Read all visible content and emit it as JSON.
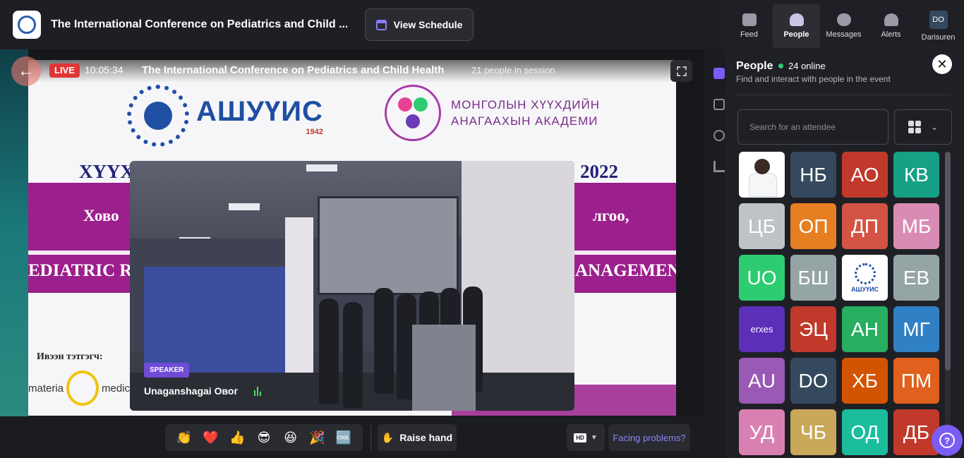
{
  "topbar": {
    "event_title": "The International Conference on Pediatrics and Child ...",
    "schedule_label": "View Schedule"
  },
  "stage": {
    "live_label": "LIVE",
    "live_time": "10:05:34",
    "session_title": "The International Conference on Pediatrics and Child Health",
    "session_count": "21 people in session",
    "slide": {
      "org1_name": "АШУҮИС",
      "org1_year": "1942",
      "org2_line1": "МОНГОЛЫН ХҮҮХДИЙН",
      "org2_line2": "АНАГААХЫН АКАДЕМИ",
      "year_left": "XYYX",
      "year_right": "2022",
      "band_left": "Хово",
      "band_right": "лгоо,",
      "band2_left": "EDIATRIC R",
      "band2_right": "ANAGEMEN",
      "sponsor_label": "Ивээн тэтгэгч:",
      "sponsor_left": "materia",
      "sponsor_right": "medica"
    },
    "speaker_badge": "SPEAKER",
    "speaker_name": "Unaganshagai Овог"
  },
  "toolbar": {
    "reactions": [
      "👏",
      "❤️",
      "👍",
      "😎",
      "😆",
      "🎉",
      "🆒"
    ],
    "raise_hand_label": "Raise hand",
    "hd_label": "HD",
    "problems_label": "Facing problems?"
  },
  "nav": {
    "items": [
      {
        "label": "Feed",
        "icon": "feed-icon"
      },
      {
        "label": "People",
        "icon": "people-icon"
      },
      {
        "label": "Messages",
        "icon": "messages-icon"
      },
      {
        "label": "Alerts",
        "icon": "bell-icon"
      },
      {
        "label": "Darisuren",
        "initials": "DO"
      }
    ],
    "active": "People"
  },
  "people": {
    "title": "People",
    "online": "24 online",
    "subtitle": "Find and interact with people in the event",
    "search_placeholder": "Search for an attendee",
    "attendees": [
      {
        "type": "photo",
        "initials": "",
        "color": "#ffffff"
      },
      {
        "initials": "НБ",
        "color": "#34495e"
      },
      {
        "initials": "АО",
        "color": "#c0392b"
      },
      {
        "initials": "КВ",
        "color": "#16a085"
      },
      {
        "initials": "ЦБ",
        "color": "#bdc3c7"
      },
      {
        "initials": "ОП",
        "color": "#e67e22"
      },
      {
        "initials": "ДП",
        "color": "#d35445"
      },
      {
        "initials": "МБ",
        "color": "#d98cb3"
      },
      {
        "initials": "UO",
        "color": "#2ecc71"
      },
      {
        "initials": "БШ",
        "color": "#95a5a6"
      },
      {
        "type": "logo",
        "initials": "АШУҮИС",
        "color": "#ffffff"
      },
      {
        "initials": "ЕВ",
        "color": "#95a5a6"
      },
      {
        "initials": "erxes",
        "color": "#5b2fb8",
        "small": true
      },
      {
        "initials": "ЭЦ",
        "color": "#c0392b"
      },
      {
        "initials": "АН",
        "color": "#27ae60"
      },
      {
        "initials": "МГ",
        "color": "#2f80c4"
      },
      {
        "initials": "AU",
        "color": "#9b59b6"
      },
      {
        "initials": "DO",
        "color": "#34495e"
      },
      {
        "initials": "ХБ",
        "color": "#d35400"
      },
      {
        "initials": "ПМ",
        "color": "#e0601e"
      },
      {
        "initials": "УД",
        "color": "#d980b3"
      },
      {
        "initials": "ЧБ",
        "color": "#c9a85a"
      },
      {
        "initials": "ОД",
        "color": "#1abc9c"
      },
      {
        "initials": "ДБ",
        "color": "#c0392b"
      }
    ]
  },
  "colors": {
    "accent": "#7b5cf5",
    "live": "#e03535",
    "online": "#2ecc71"
  }
}
